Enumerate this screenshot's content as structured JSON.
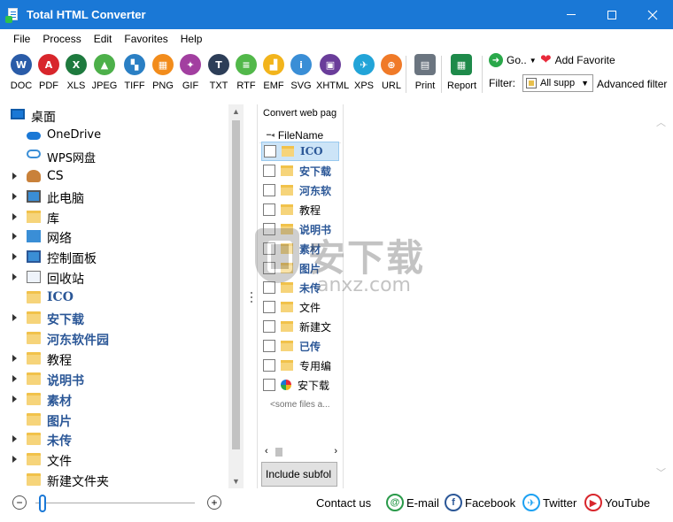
{
  "window": {
    "title": "Total HTML Converter"
  },
  "menu": [
    "File",
    "Process",
    "Edit",
    "Favorites",
    "Help"
  ],
  "toolbar": {
    "buttons": [
      {
        "label": "DOC",
        "glyph": "W",
        "color": "#2a5ca8",
        "icon": "doc-icon"
      },
      {
        "label": "PDF",
        "glyph": "A",
        "color": "#d8262c",
        "icon": "pdf-icon"
      },
      {
        "label": "XLS",
        "glyph": "X",
        "color": "#1e7a3e",
        "icon": "xls-icon"
      },
      {
        "label": "JPEG",
        "glyph": "▲",
        "color": "#4db04a",
        "icon": "jpeg-icon"
      },
      {
        "label": "TIFF",
        "glyph": "▚",
        "color": "#2a7fc4",
        "icon": "tiff-icon"
      },
      {
        "label": "PNG",
        "glyph": "▦",
        "color": "#f28c1c",
        "icon": "png-icon"
      },
      {
        "label": "GIF",
        "glyph": "✦",
        "color": "#a23fa0",
        "icon": "gif-icon"
      },
      {
        "label": "TXT",
        "glyph": "T",
        "color": "#2d3e58",
        "icon": "txt-icon"
      },
      {
        "label": "RTF",
        "glyph": "≡",
        "color": "#52b84a",
        "icon": "rtf-icon"
      },
      {
        "label": "EMF",
        "glyph": "▟",
        "color": "#f2b41c",
        "icon": "emf-icon"
      },
      {
        "label": "SVG",
        "glyph": "i",
        "color": "#3a8ed6",
        "icon": "svg-icon"
      },
      {
        "label": "XHTML",
        "glyph": "▣",
        "color": "#6a3d9a",
        "icon": "xhtml-icon"
      },
      {
        "label": "XPS",
        "glyph": "✈",
        "color": "#22a4d8",
        "icon": "xps-icon"
      },
      {
        "label": "URL",
        "glyph": "⊕",
        "color": "#f07a28",
        "icon": "url-icon"
      },
      {
        "label": "Print",
        "glyph": "▤",
        "color": "#6b7580",
        "icon": "print-icon"
      },
      {
        "label": "Report",
        "glyph": "▦",
        "color": "#1e8a4a",
        "icon": "report-icon"
      }
    ],
    "go_label": "Go..",
    "add_favorite_label": "Add Favorite",
    "filter_label": "Filter:",
    "filter_value": "All supp",
    "advanced_filter_label": "Advanced filter"
  },
  "tree": {
    "items": [
      {
        "label": "桌面",
        "icon": "desktop-icon",
        "expander": false,
        "style": "normal"
      },
      {
        "label": "OneDrive",
        "icon": "onedrive-icon",
        "expander": false,
        "style": "normal"
      },
      {
        "label": "WPS网盘",
        "icon": "cloud-icon",
        "expander": false,
        "style": "normal"
      },
      {
        "label": "CS",
        "icon": "user-icon",
        "expander": true,
        "style": "normal"
      },
      {
        "label": "此电脑",
        "icon": "computer-icon",
        "expander": true,
        "style": "normal"
      },
      {
        "label": "库",
        "icon": "library-icon",
        "expander": true,
        "style": "normal"
      },
      {
        "label": "网络",
        "icon": "network-icon",
        "expander": true,
        "style": "normal"
      },
      {
        "label": "控制面板",
        "icon": "control-panel-icon",
        "expander": true,
        "style": "normal"
      },
      {
        "label": "回收站",
        "icon": "recycle-bin-icon",
        "expander": true,
        "style": "normal"
      },
      {
        "label": "ICO",
        "icon": "folder-icon",
        "expander": false,
        "style": "blue"
      },
      {
        "label": "安下载",
        "icon": "folder-icon",
        "expander": true,
        "style": "blue"
      },
      {
        "label": "河东软件园",
        "icon": "folder-icon",
        "expander": false,
        "style": "blue"
      },
      {
        "label": "教程",
        "icon": "folder-icon",
        "expander": true,
        "style": "normal"
      },
      {
        "label": "说明书",
        "icon": "folder-icon",
        "expander": true,
        "style": "blue"
      },
      {
        "label": "素材",
        "icon": "folder-icon",
        "expander": true,
        "style": "blue"
      },
      {
        "label": "图片",
        "icon": "folder-icon",
        "expander": false,
        "style": "blue"
      },
      {
        "label": "未传",
        "icon": "folder-icon",
        "expander": true,
        "style": "blue"
      },
      {
        "label": "文件",
        "icon": "folder-icon",
        "expander": true,
        "style": "normal"
      },
      {
        "label": "新建文件夹",
        "icon": "folder-icon",
        "expander": false,
        "style": "normal"
      }
    ]
  },
  "files": {
    "tab_label": "Convert web pag",
    "column_header": "FileName",
    "rows": [
      {
        "name": "ICO",
        "style": "blue",
        "selected": true,
        "icon": "folder-icon"
      },
      {
        "name": "安下载",
        "style": "blue",
        "selected": false,
        "icon": "folder-icon"
      },
      {
        "name": "河东软",
        "style": "blue",
        "selected": false,
        "icon": "folder-icon"
      },
      {
        "name": "教程",
        "style": "normal",
        "selected": false,
        "icon": "folder-icon"
      },
      {
        "name": "说明书",
        "style": "blue",
        "selected": false,
        "icon": "folder-icon"
      },
      {
        "name": "素材",
        "style": "blue",
        "selected": false,
        "icon": "folder-icon"
      },
      {
        "name": "图片",
        "style": "blue",
        "selected": false,
        "icon": "folder-icon"
      },
      {
        "name": "未传",
        "style": "blue",
        "selected": false,
        "icon": "folder-icon"
      },
      {
        "name": "文件",
        "style": "normal",
        "selected": false,
        "icon": "folder-icon"
      },
      {
        "name": "新建文",
        "style": "normal",
        "selected": false,
        "icon": "folder-icon"
      },
      {
        "name": "已传",
        "style": "blue",
        "selected": false,
        "icon": "folder-icon"
      },
      {
        "name": "专用编",
        "style": "normal",
        "selected": false,
        "icon": "folder-icon"
      },
      {
        "name": "安下载",
        "style": "normal",
        "selected": false,
        "icon": "app-file-icon"
      }
    ],
    "more_text": "<some files a...",
    "include_subfolders_label": "Include subfol"
  },
  "watermark": {
    "main": "安下载",
    "sub": "anxz.com"
  },
  "footer": {
    "contact_label": "Contact us",
    "links": [
      {
        "label": "E-mail",
        "icon": "email-icon",
        "glyph": "@",
        "color": "#2a9a4a"
      },
      {
        "label": "Facebook",
        "icon": "facebook-icon",
        "glyph": "f",
        "color": "#2b5797"
      },
      {
        "label": "Twitter",
        "icon": "twitter-icon",
        "glyph": "✈",
        "color": "#1da1f2"
      },
      {
        "label": "YouTube",
        "icon": "youtube-icon",
        "glyph": "▶",
        "color": "#d8262c"
      }
    ],
    "zoom_minus": "−",
    "zoom_plus": "+"
  },
  "colors": {
    "titlebar": "#1a78d6",
    "folder": "#f6d47a",
    "blue_text": "#2b5797",
    "selection": "#cce4f7"
  }
}
